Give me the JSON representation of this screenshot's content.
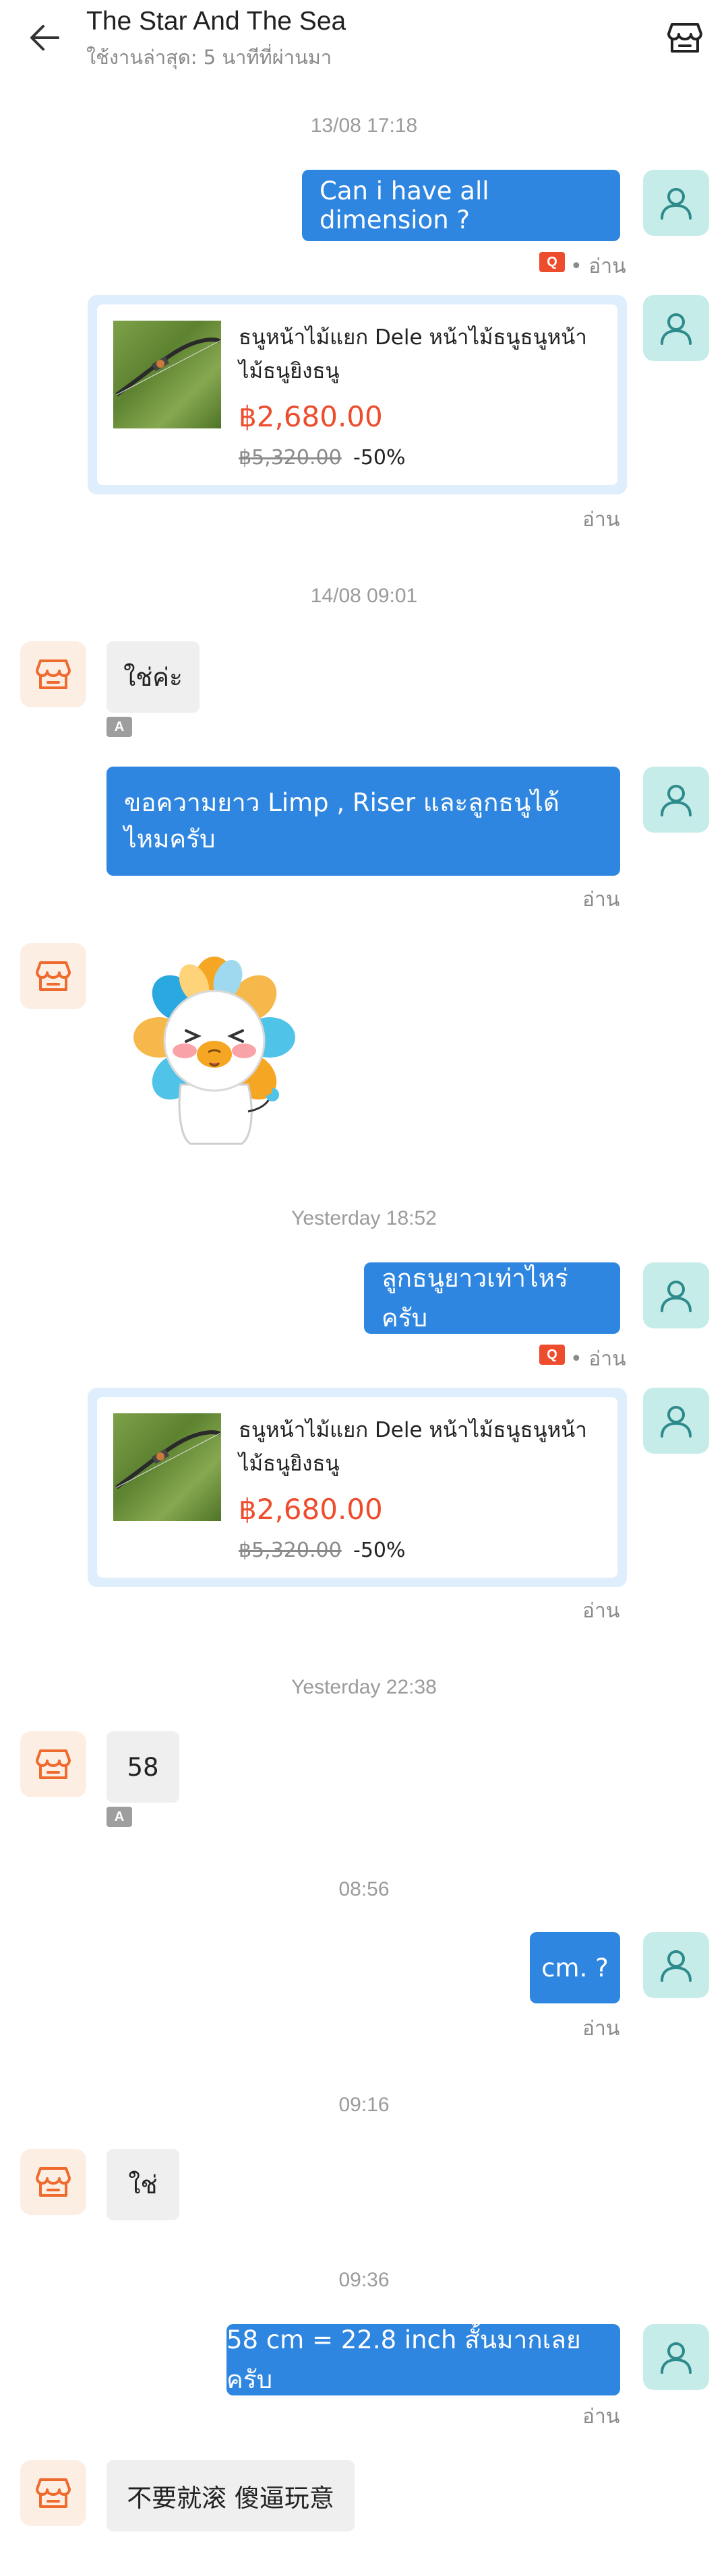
{
  "header": {
    "title": "The Star And The Sea",
    "subtitle": "ใช้งานล่าสุด: 5 นาทีที่ผ่านมา"
  },
  "timestamps": [
    "13/08 17:18",
    "14/08 09:01",
    "Yesterday 18:52",
    "Yesterday 22:38",
    "08:56",
    "09:16",
    "09:36"
  ],
  "read_label": "อ่าน",
  "read_dot_label": "• อ่าน",
  "q_badge": "Q",
  "a_badge": "A",
  "product": {
    "name": "ธนูหน้าไม้แยก Dele หน้าไม้ธนูธนูหน้าไม้ธนูยิงธนู",
    "price": "฿2,680.00",
    "original_price": "฿5,320.00",
    "discount": "-50%"
  },
  "messages": {
    "m1": "Can i have all dimension ?",
    "m2": "ใช่ค่ะ",
    "m3": "ขอความยาว Limp ,  Riser และลูกธนูได้ไหมครับ",
    "m4": "ลูกธนูยาวเท่าไหร่ครับ",
    "m5": "58",
    "m6": "cm. ?",
    "m7": "ใช่",
    "m8": "58 cm = 22.8 inch สั้นมากเลยครับ",
    "m9": "不要就滚  傻逼玩意"
  },
  "icons": {
    "back": "back-arrow-icon",
    "shop": "shop-icon",
    "user": "user-icon",
    "sticker": "lion-sticker"
  },
  "colors": {
    "outgoing_bubble": "#2f86e0",
    "incoming_bubble": "#efefef",
    "price": "#ee4d2d",
    "user_avatar_bg": "#c6ecea",
    "shop_avatar_bg": "#fdeee4"
  }
}
